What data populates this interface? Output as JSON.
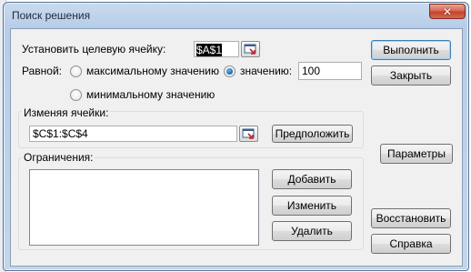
{
  "window": {
    "title": "Поиск решения"
  },
  "target": {
    "label": "Установить целевую ячейку:",
    "value": "$A$1"
  },
  "equal": {
    "label": "Равной:",
    "options": [
      {
        "label": "максимальному значению",
        "checked": false
      },
      {
        "label": "значению:",
        "checked": true
      },
      {
        "label": "минимальному значению",
        "checked": false
      }
    ],
    "value": "100"
  },
  "changing": {
    "label": "Изменяя ячейки:",
    "value": "$C$1:$C$4",
    "guess_button": "Предположить"
  },
  "constraints": {
    "label": "Ограничения:",
    "add_button": "Добавить",
    "change_button": "Изменить",
    "delete_button": "Удалить"
  },
  "side_buttons": {
    "solve": "Выполнить",
    "close": "Закрыть",
    "options": "Параметры",
    "reset": "Восстановить",
    "help": "Справка"
  }
}
